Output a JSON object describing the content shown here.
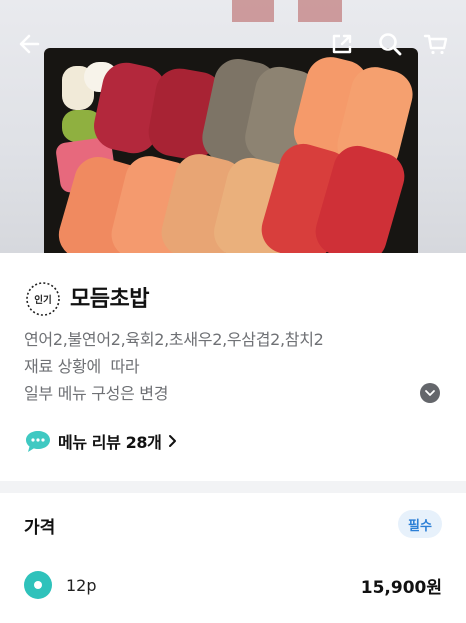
{
  "header": {
    "back_icon": "arrow-left-icon",
    "share_icon": "share-icon",
    "search_icon": "search-icon",
    "cart_icon": "cart-icon"
  },
  "product": {
    "badge_text": "인기",
    "title": "모듬초밥",
    "description_lines": [
      "연어2,불연어2,육회2,초새우2,우삼겹2,참치2",
      "재료 상황에  따라",
      "일부 메뉴 구성은 변경"
    ],
    "expand_icon": "chevron-down-icon",
    "review_label": "메뉴 리뷰 28개"
  },
  "price_section": {
    "title": "가격",
    "required_badge": "필수",
    "options": [
      {
        "label": "12p",
        "price": "15,900원",
        "selected": true
      }
    ]
  },
  "colors": {
    "accent_teal": "#2fc2bb",
    "required_blue": "#2c7fd6"
  }
}
